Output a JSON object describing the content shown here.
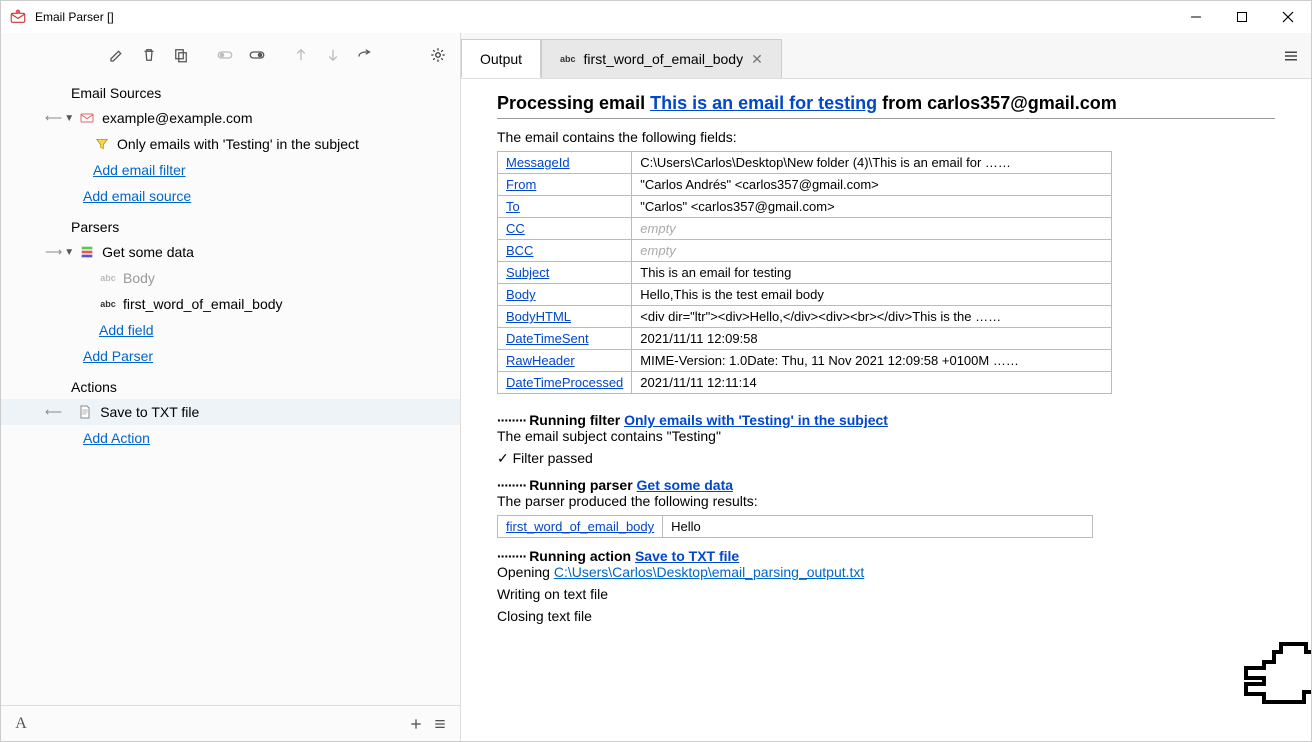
{
  "window": {
    "title": "Email Parser []"
  },
  "tree": {
    "sections": {
      "sources": {
        "header": "Email Sources",
        "account": "example@example.com",
        "filter": "Only emails with 'Testing' in the subject",
        "add_filter_link": "Add email filter",
        "add_source_link": "Add email source"
      },
      "parsers": {
        "header": "Parsers",
        "parser_name": "Get some data",
        "body_field": "Body",
        "firstword_field": "first_word_of_email_body",
        "add_field_link": "Add field",
        "add_parser_link": "Add Parser"
      },
      "actions": {
        "header": "Actions",
        "action_name": "Save to TXT file",
        "add_action_link": "Add Action"
      }
    }
  },
  "tabs": {
    "output": "Output",
    "second": "first_word_of_email_body"
  },
  "output": {
    "heading_pre": "Processing email ",
    "heading_link": "This is an email for testing",
    "heading_post": " from carlos357@gmail.com",
    "fields_intro": "The email contains the following fields:",
    "fields": [
      {
        "k": "MessageId",
        "v": "C:\\Users\\Carlos\\Desktop\\New folder (4)\\This is an email for  ……"
      },
      {
        "k": "From",
        "v": "\"Carlos Andrés\" <carlos357@gmail.com>"
      },
      {
        "k": "To",
        "v": "\"Carlos\" <carlos357@gmail.com>"
      },
      {
        "k": "CC",
        "v": "empty",
        "empty": true
      },
      {
        "k": "BCC",
        "v": "empty",
        "empty": true
      },
      {
        "k": "Subject",
        "v": "This is an email for testing"
      },
      {
        "k": "Body",
        "v": "Hello,This is the test email body"
      },
      {
        "k": "BodyHTML",
        "v": "<div dir=\"ltr\"><div>Hello,</div><div><br></div>This is the   ……"
      },
      {
        "k": "DateTimeSent",
        "v": "2021/11/11 12:09:58"
      },
      {
        "k": "RawHeader",
        "v": "MIME-Version: 1.0Date: Thu, 11 Nov 2021 12:09:58 +0100M  ……"
      },
      {
        "k": "DateTimeProcessed",
        "v": "2021/11/11 12:11:14"
      }
    ],
    "filter": {
      "title_pre": "Running filter ",
      "title_link": "Only emails with 'Testing' in the subject",
      "line1": "The email subject contains \"Testing\"",
      "line2": "✓ Filter passed"
    },
    "parser": {
      "title_pre": "Running parser ",
      "title_link": "Get some data",
      "intro": "The parser produced the following results:",
      "result_key_link": "first_word_of_email_body",
      "result_val": "Hello"
    },
    "action": {
      "title_pre": "Running action ",
      "title_link": "Save to TXT file",
      "opening_pre": "Opening ",
      "opening_link": "C:\\Users\\Carlos\\Desktop\\email_parsing_output.txt",
      "line2": "Writing on text file",
      "line3": "Closing text file"
    }
  }
}
